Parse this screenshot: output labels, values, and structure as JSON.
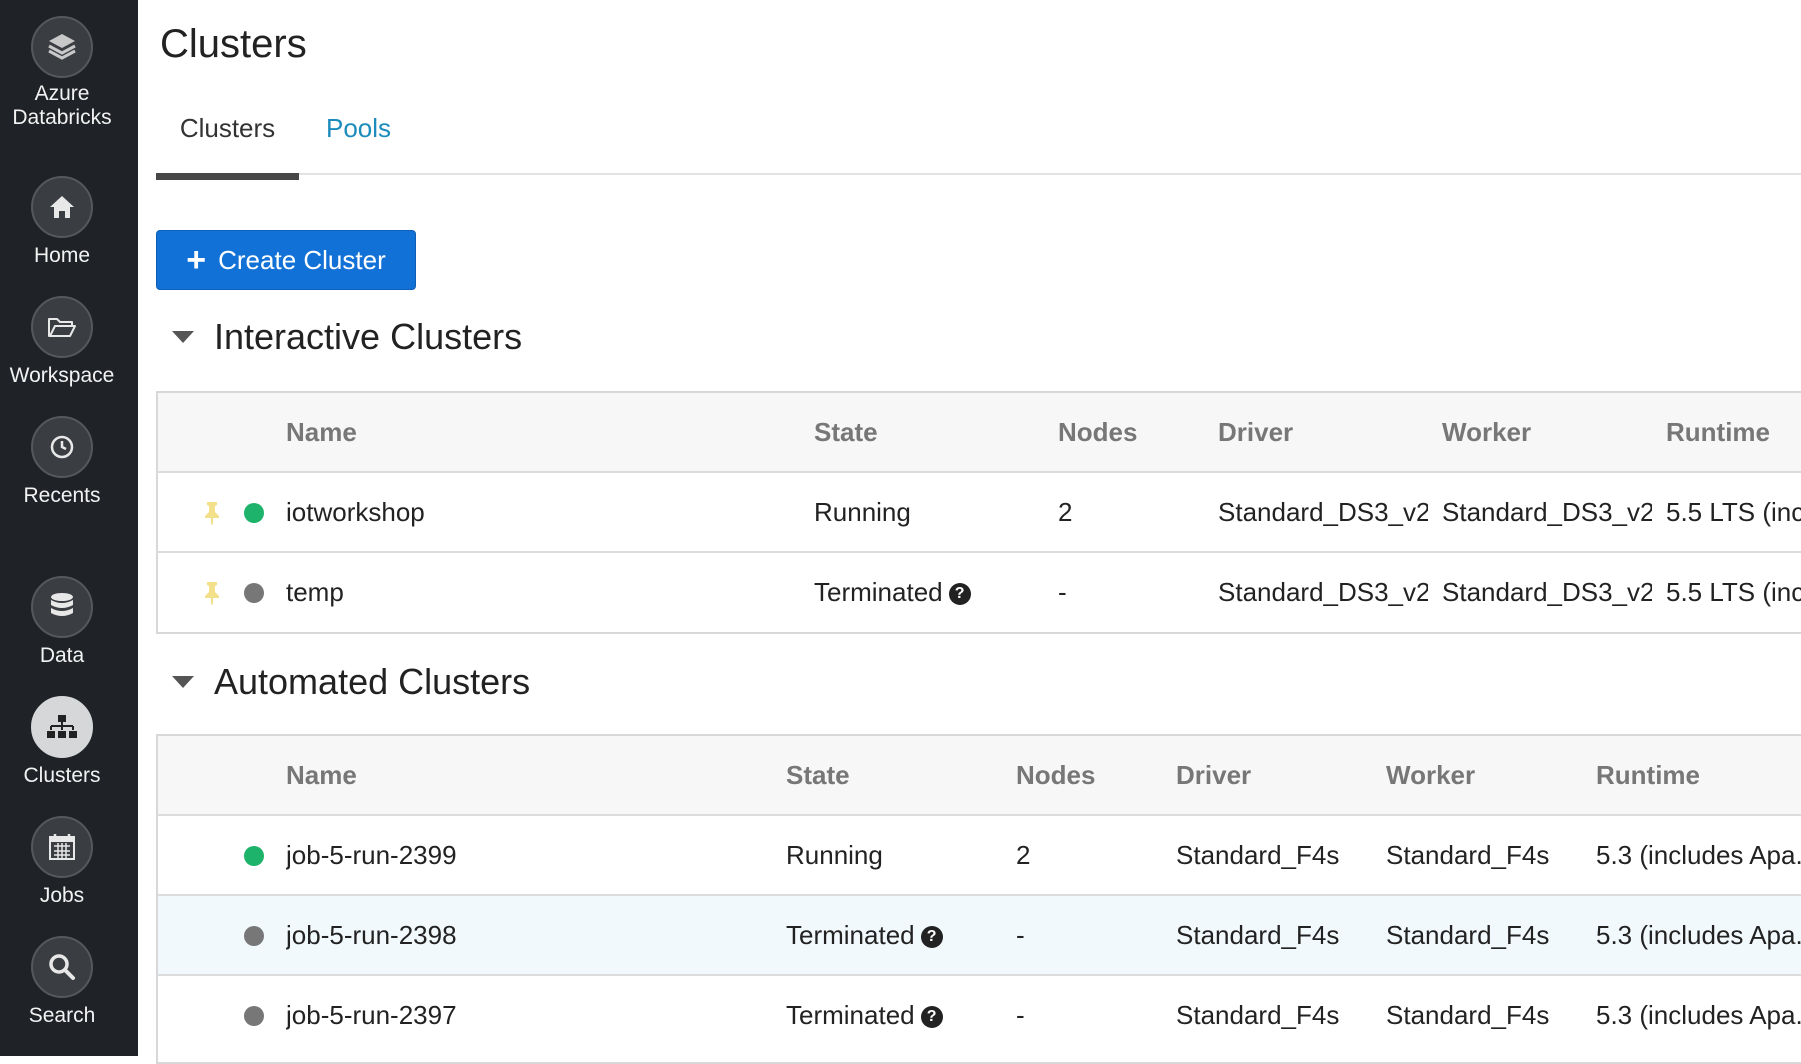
{
  "sidebar": {
    "brand_line1": "Azure",
    "brand_line2": "Databricks",
    "items": [
      {
        "label": "Home",
        "icon": "home-icon"
      },
      {
        "label": "Workspace",
        "icon": "folder-icon"
      },
      {
        "label": "Recents",
        "icon": "clock-icon"
      },
      {
        "label": "Data",
        "icon": "database-icon"
      },
      {
        "label": "Clusters",
        "icon": "cluster-icon",
        "active": true
      },
      {
        "label": "Jobs",
        "icon": "calendar-icon"
      },
      {
        "label": "Search",
        "icon": "search-icon"
      }
    ]
  },
  "page": {
    "title": "Clusters"
  },
  "tabs": {
    "clusters": "Clusters",
    "pools": "Pools"
  },
  "create_button": {
    "label": "Create Cluster"
  },
  "interactive": {
    "title": "Interactive Clusters",
    "headers": [
      "Name",
      "State",
      "Nodes",
      "Driver",
      "Worker",
      "Runtime"
    ],
    "rows": [
      {
        "name": "iotworkshop",
        "state": "Running",
        "nodes": "2",
        "driver": "Standard_DS3_v2",
        "worker": "Standard_DS3_v2",
        "runtime": "5.5 LTS (inc",
        "status": "running",
        "pinned": true
      },
      {
        "name": "temp",
        "state": "Terminated",
        "nodes": "-",
        "driver": "Standard_DS3_v2",
        "worker": "Standard_DS3_v2",
        "runtime": "5.5 LTS (inc",
        "status": "terminated",
        "pinned": true
      }
    ]
  },
  "automated": {
    "title": "Automated Clusters",
    "headers": [
      "Name",
      "State",
      "Nodes",
      "Driver",
      "Worker",
      "Runtime"
    ],
    "rows": [
      {
        "name": "job-5-run-2399",
        "state": "Running",
        "nodes": "2",
        "driver": "Standard_F4s",
        "worker": "Standard_F4s",
        "runtime": "5.3 (includes Apa...",
        "status": "running"
      },
      {
        "name": "job-5-run-2398",
        "state": "Terminated",
        "nodes": "-",
        "driver": "Standard_F4s",
        "worker": "Standard_F4s",
        "runtime": "5.3 (includes Apa...",
        "status": "terminated"
      },
      {
        "name": "job-5-run-2397",
        "state": "Terminated",
        "nodes": "-",
        "driver": "Standard_F4s",
        "worker": "Standard_F4s",
        "runtime": "5.3 (includes Apa...",
        "status": "terminated"
      }
    ]
  },
  "colors": {
    "running": "#1db36b",
    "terminated": "#777777",
    "accent": "#1271d6",
    "pin": "#f3e08a"
  }
}
